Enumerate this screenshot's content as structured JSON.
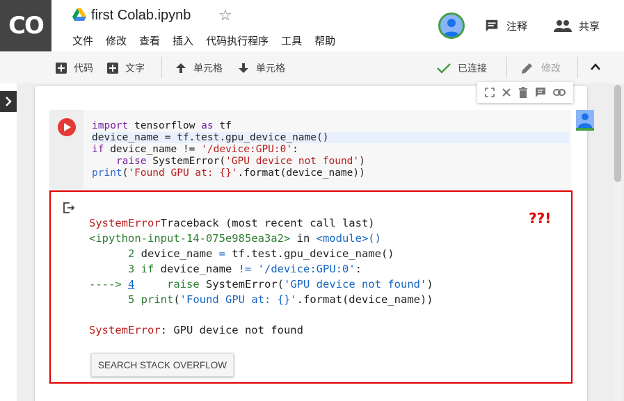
{
  "app": {
    "logo": "CO",
    "notebook_title": "first Colab.ipynb"
  },
  "menu": [
    "文件",
    "修改",
    "查看",
    "插入",
    "代码执行程序",
    "工具",
    "帮助"
  ],
  "header_actions": {
    "comment_label": "注释",
    "share_label": "共享"
  },
  "toolbar": {
    "add_code": "代码",
    "add_text": "文字",
    "cell_up": "单元格",
    "cell_down": "单元格",
    "status": "已连接",
    "edit": "修改"
  },
  "cell": {
    "code_lines": [
      "import tensorflow as tf",
      "device_name = tf.test.gpu_device_name()",
      "if device_name != '/device:GPU:0':",
      "    raise SystemError('GPU device not found')",
      "print('Found GPU at: {}'.format(device_name))"
    ]
  },
  "output": {
    "annotation": "??!",
    "traceback": [
      "SystemErrorTraceback (most recent call last)",
      "<ipython-input-14-075e985ea3a2> in <module>()",
      "      2 device_name = tf.test.gpu_device_name()",
      "      3 if device_name != '/device:GPU:0':",
      "----> 4     raise SystemError('GPU device not found')",
      "      5 print('Found GPU at: {}'.format(device_name))",
      "",
      "SystemError: GPU device not found"
    ],
    "search_button": "SEARCH STACK OVERFLOW"
  },
  "colors": {
    "logo_bg": "#444444",
    "run_button": "#e53935",
    "error_border": "#e00000",
    "connected_check": "#43a047"
  },
  "icons": [
    "drive-icon",
    "star-icon",
    "comment-icon",
    "people-icon",
    "plus-icon",
    "arrow-up-icon",
    "arrow-down-icon",
    "check-icon",
    "pencil-icon",
    "chevron-up-icon",
    "chevron-right-icon",
    "play-icon",
    "expand-icon",
    "close-icon",
    "delete-icon",
    "comment-icon",
    "link-icon",
    "output-icon"
  ]
}
